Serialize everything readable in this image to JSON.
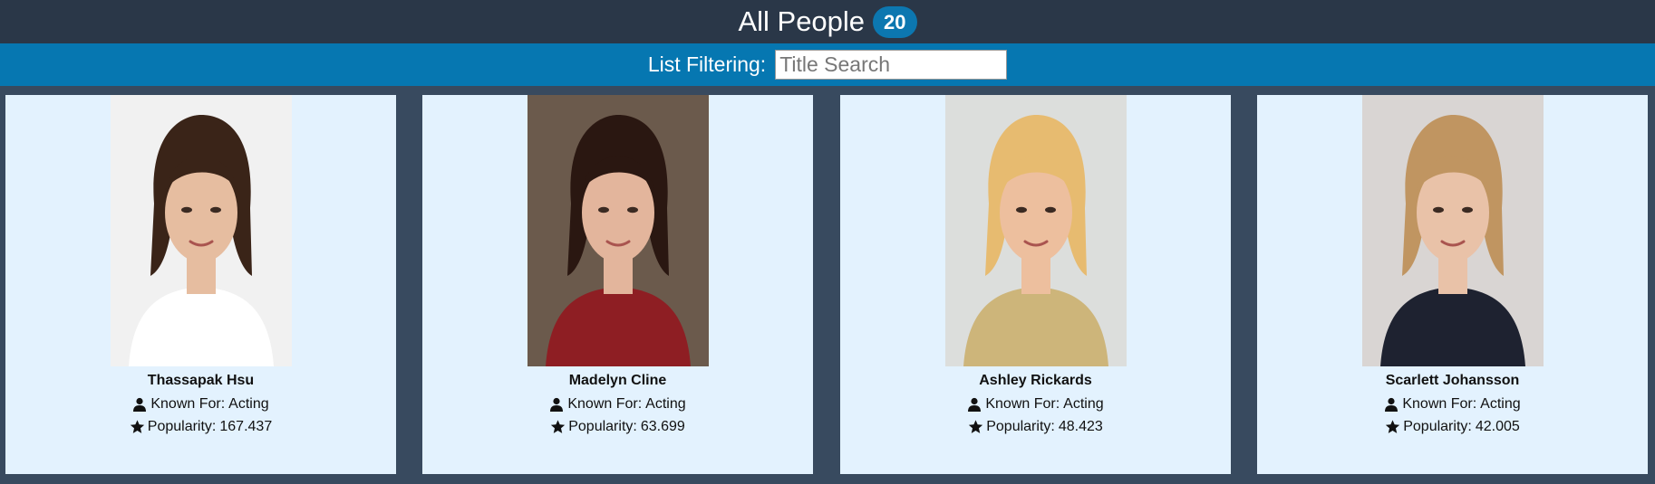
{
  "header": {
    "title": "All People",
    "count": "20"
  },
  "filter": {
    "label": "List Filtering:",
    "placeholder": "Title Search",
    "value": ""
  },
  "people": [
    {
      "name": "Thassapak Hsu",
      "known_for_label": "Known For:",
      "known_for": "Acting",
      "popularity_label": "Popularity:",
      "popularity": "167.437",
      "photo": {
        "bg": "#f1f1f1",
        "hair": "#3a2418",
        "skin": "#e6bda0",
        "clothes": "#ffffff"
      }
    },
    {
      "name": "Madelyn Cline",
      "known_for_label": "Known For:",
      "known_for": "Acting",
      "popularity_label": "Popularity:",
      "popularity": "63.699",
      "photo": {
        "bg": "#6b5a4c",
        "hair": "#2a1711",
        "skin": "#e3b59c",
        "clothes": "#8e1e23"
      }
    },
    {
      "name": "Ashley Rickards",
      "known_for_label": "Known For:",
      "known_for": "Acting",
      "popularity_label": "Popularity:",
      "popularity": "48.423",
      "photo": {
        "bg": "#dcdedc",
        "hair": "#e7bb70",
        "skin": "#edbf9e",
        "clothes": "#cdb57a"
      }
    },
    {
      "name": "Scarlett Johansson",
      "known_for_label": "Known For:",
      "known_for": "Acting",
      "popularity_label": "Popularity:",
      "popularity": "42.005",
      "photo": {
        "bg": "#d9d5d3",
        "hair": "#c09561",
        "skin": "#e9c2a8",
        "clothes": "#1e2230"
      }
    }
  ]
}
